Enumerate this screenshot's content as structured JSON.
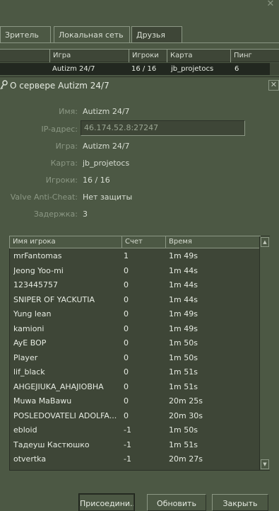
{
  "window": {
    "close_glyph": "✕"
  },
  "tabs": [
    "Зритель",
    "Локальная сеть",
    "Друзья"
  ],
  "server_list": {
    "columns": [
      "Игра",
      "Игроки",
      "Карта",
      "Пинг"
    ],
    "row": {
      "game": "Autizm 24/7",
      "players": "16 / 16",
      "map": "jb_projetocs",
      "ping": "6"
    }
  },
  "dialog": {
    "title": "О сервере Autizm 24/7",
    "title_icon": "key-icon",
    "close_glyph": "✕",
    "info": [
      {
        "label": "Имя:",
        "value": "Autizm 24/7"
      },
      {
        "label": "IP-адрес:",
        "value": "46.174.52.8:27247"
      },
      {
        "label": "Игра:",
        "value": "Autizm 24/7"
      },
      {
        "label": "Карта:",
        "value": "jb_projetocs"
      },
      {
        "label": "Игроки:",
        "value": "16 / 16"
      },
      {
        "label": "Valve Anti-Cheat:",
        "value": "Нет защиты"
      },
      {
        "label": "Задержка:",
        "value": "3"
      }
    ],
    "players_table": {
      "columns": [
        "Имя игрока",
        "Счет",
        "Время"
      ],
      "rows": [
        [
          "mrFantomas",
          "1",
          "1m 49s"
        ],
        [
          "Jeong Yoo-mi",
          "0",
          "1m 44s"
        ],
        [
          "123445757",
          "0",
          "1m 44s"
        ],
        [
          "SNIPER OF YACKUTIA",
          "0",
          "1m 44s"
        ],
        [
          "Yung lean",
          "0",
          "1m 49s"
        ],
        [
          "kamioni",
          "0",
          "1m 49s"
        ],
        [
          "AyE BOP",
          "0",
          "1m 50s"
        ],
        [
          "Player",
          "0",
          "1m 50s"
        ],
        [
          "lif_black",
          "0",
          "1m 51s"
        ],
        [
          "AHGEJIUKA_AHAJIOBHA",
          "0",
          "1m 51s"
        ],
        [
          "Muwa MaBawu",
          "0",
          "20m 25s"
        ],
        [
          "POSLEDOVATELI ADOLFA...",
          "0",
          "20m 30s"
        ],
        [
          "ebloid",
          "-1",
          "1m 50s"
        ],
        [
          "Тадеуш Кастюшко",
          "-1",
          "1m 51s"
        ],
        [
          "otvertka",
          "-1",
          "20m 27s"
        ]
      ]
    },
    "buttons": {
      "join": "Присоедини...",
      "refresh": "Обновить",
      "close": "Закрыть"
    }
  },
  "colors": {
    "bg": "#4c5844",
    "dark": "#3e4637",
    "selected_row": "#222820",
    "label": "#8b9784",
    "text": "#d8ded3"
  }
}
